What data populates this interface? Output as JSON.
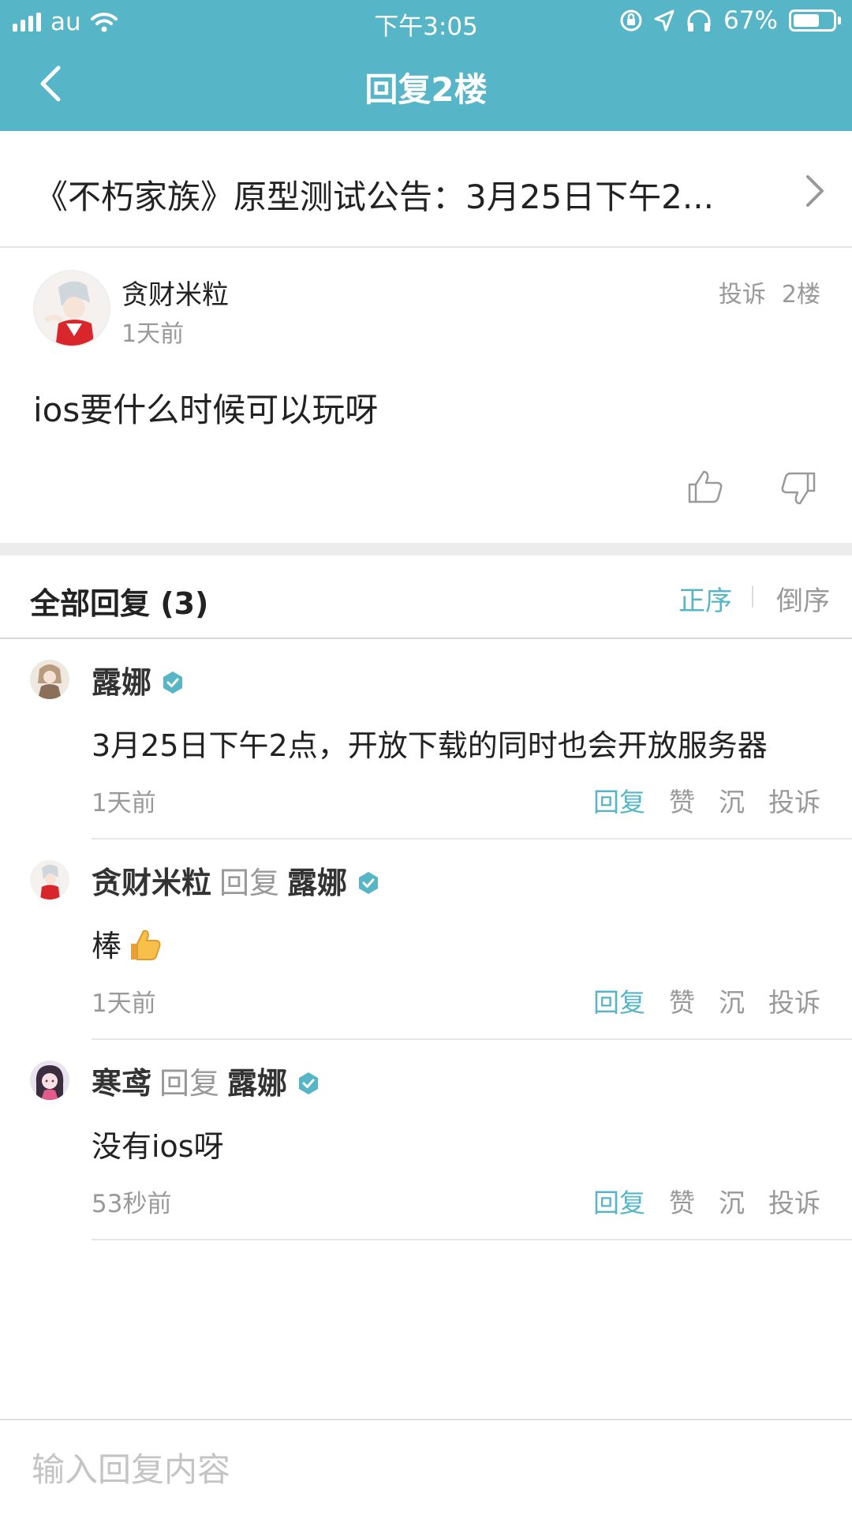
{
  "status_bar": {
    "carrier": "au",
    "time": "下午3:05",
    "battery": "67%",
    "battery_level": 0.67
  },
  "nav": {
    "title": "回复2楼",
    "back_icon": "chevron-left-icon"
  },
  "thread": {
    "title": "《不朽家族》原型测试公告：3月25日下午2...",
    "chevron_icon": "chevron-right-icon"
  },
  "post": {
    "author": "贪财米粒",
    "time": "1天前",
    "report": "投诉",
    "floor": "2楼",
    "content": "ios要什么时候可以玩呀",
    "like_icon": "thumb-up-icon",
    "dislike_icon": "thumb-down-icon"
  },
  "replies_header": {
    "title": "全部回复 (3)",
    "sort_asc": "正序",
    "sort_desc": "倒序"
  },
  "replies": [
    {
      "author": "露娜",
      "verified": true,
      "reply_word": "",
      "target": "",
      "content": "3月25日下午2点，开放下载的同时也会开放服务器",
      "time": "1天前"
    },
    {
      "author": "贪财米粒",
      "verified": false,
      "reply_word": "回复",
      "target": "露娜",
      "content": "棒",
      "time": "1天前"
    },
    {
      "author": "寒鸢",
      "verified": false,
      "reply_word": "回复",
      "target": "露娜",
      "content": "没有ios呀",
      "time": "53秒前"
    }
  ],
  "reply_actions": {
    "reply": "回复",
    "like": "赞",
    "sink": "沉",
    "report": "投诉"
  },
  "input": {
    "placeholder": "输入回复内容"
  },
  "colors": {
    "accent": "#56b5c7",
    "muted": "#999999"
  }
}
